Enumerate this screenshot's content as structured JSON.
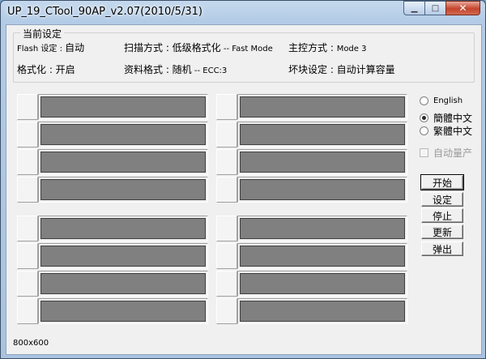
{
  "window": {
    "title": "UP_19_CTool_90AP_v2.07(2010/5/31)",
    "buttons": {
      "minimize": "▁",
      "maximize": "□",
      "close": "✕"
    }
  },
  "settings": {
    "group_title": "当前设定",
    "flash_label": "Flash 设定 : ",
    "flash_value": "自动",
    "scan_label": "扫描方式 : 低级格式化",
    "scan_value": " -- Fast Mode",
    "control_label": "主控方式 : ",
    "control_value": "Mode 3",
    "format_label": "格式化 : 开启",
    "data_label": "资料格式 : 随机",
    "data_value": " -- ECC:3",
    "badblock_label": "坏块设定 : 自动计算容量"
  },
  "slots": {
    "count": 16,
    "fill_color": "#808080"
  },
  "language": {
    "options": [
      {
        "label": "English",
        "selected": false
      },
      {
        "label": "簡體中文",
        "selected": true
      },
      {
        "label": "繁體中文",
        "selected": false
      }
    ]
  },
  "auto_produce": {
    "label": "自动量产",
    "checked": false,
    "enabled": false
  },
  "actions": {
    "start": "开始",
    "settings": "设定",
    "stop": "停止",
    "refresh": "更新",
    "eject": "弹出"
  },
  "status": {
    "resolution": "800x600"
  }
}
